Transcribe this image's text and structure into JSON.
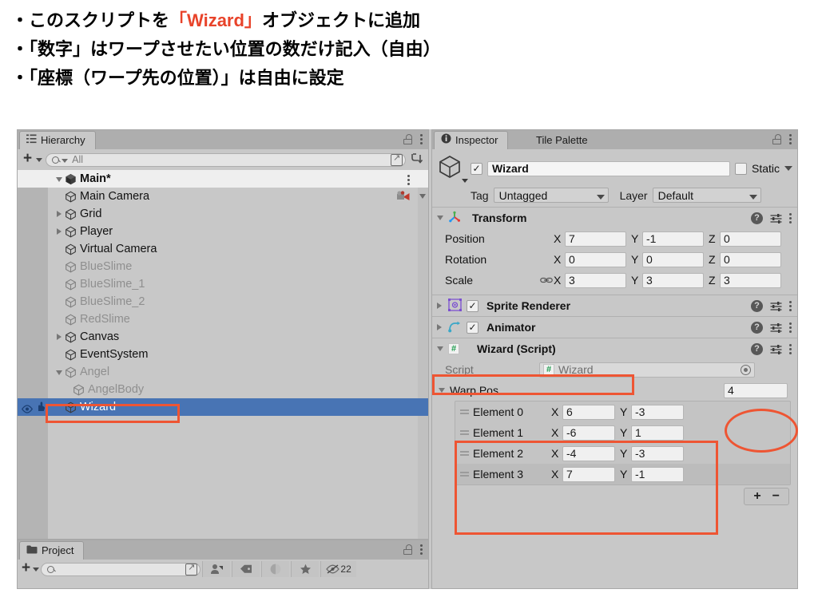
{
  "slide": {
    "bullets": [
      {
        "pre": "・このスクリプトを",
        "red": "「Wizard」",
        "post": "オブジェクトに追加"
      },
      {
        "pre": "・「数字」はワープさせたい位置の数だけ記入（自由）",
        "red": "",
        "post": ""
      },
      {
        "pre": "・「座標（ワープ先の位置）」は自由に設定",
        "red": "",
        "post": ""
      }
    ],
    "accent_color": "#e8432a"
  },
  "hierarchy": {
    "tab_label": "Hierarchy",
    "tab_icon": "hierarchy-icon",
    "lock_icon": "lock-icon",
    "menu_icon": "kebab-icon",
    "add_label": "+",
    "search_placeholder": "All",
    "search_icon": "search-icon",
    "sort_icon": "sort-icon",
    "root": {
      "label": "Main*",
      "expanded": true
    },
    "items": [
      {
        "label": "Main Camera",
        "indent": 2,
        "twisty": "none",
        "dim": false,
        "selected": false,
        "badge": "camera-icon"
      },
      {
        "label": "Grid",
        "indent": 2,
        "twisty": "right",
        "dim": false,
        "selected": false
      },
      {
        "label": "Player",
        "indent": 2,
        "twisty": "right",
        "dim": false,
        "selected": false
      },
      {
        "label": "Virtual Camera",
        "indent": 2,
        "twisty": "none",
        "dim": false,
        "selected": false
      },
      {
        "label": "BlueSlime",
        "indent": 2,
        "twisty": "none",
        "dim": true,
        "selected": false
      },
      {
        "label": "BlueSlime_1",
        "indent": 2,
        "twisty": "none",
        "dim": true,
        "selected": false
      },
      {
        "label": "BlueSlime_2",
        "indent": 2,
        "twisty": "none",
        "dim": true,
        "selected": false
      },
      {
        "label": "RedSlime",
        "indent": 2,
        "twisty": "none",
        "dim": true,
        "selected": false
      },
      {
        "label": "Canvas",
        "indent": 2,
        "twisty": "right",
        "dim": false,
        "selected": false
      },
      {
        "label": "EventSystem",
        "indent": 2,
        "twisty": "none",
        "dim": false,
        "selected": false
      },
      {
        "label": "Angel",
        "indent": 2,
        "twisty": "down",
        "dim": true,
        "selected": false
      },
      {
        "label": "AngelBody",
        "indent": 3,
        "twisty": "none",
        "dim": true,
        "selected": false
      },
      {
        "label": "Wizard",
        "indent": 2,
        "twisty": "none",
        "dim": false,
        "selected": true
      }
    ]
  },
  "project": {
    "tab_label": "Project",
    "tab_icon": "folder-icon",
    "add_label": "+",
    "search_placeholder": "",
    "filter_icons": [
      "search-icon",
      "asset-icon",
      "label-icon",
      "warning-icon",
      "favorite-icon",
      "hidden-icon"
    ],
    "hidden_count": "22"
  },
  "inspector": {
    "tabs": [
      {
        "label": "Inspector",
        "icon": "info-icon",
        "active": true
      },
      {
        "label": "Tile Palette",
        "icon": "",
        "active": false
      }
    ],
    "lock_icon": "lock-icon",
    "menu_icon": "kebab-icon",
    "object": {
      "icon": "gameobject-icon",
      "enabled": true,
      "name": "Wizard",
      "static_label": "Static",
      "static_checked": false,
      "tag_label": "Tag",
      "tag_value": "Untagged",
      "layer_label": "Layer",
      "layer_value": "Default"
    },
    "transform": {
      "title": "Transform",
      "icon": "transform-icon",
      "expanded": true,
      "rows": [
        {
          "name": "Position",
          "linked": false,
          "x": "7",
          "y": "-1",
          "z": "0"
        },
        {
          "name": "Rotation",
          "linked": false,
          "x": "0",
          "y": "0",
          "z": "0"
        },
        {
          "name": "Scale",
          "linked": true,
          "x": "3",
          "y": "3",
          "z": "3"
        }
      ],
      "axis_labels": [
        "X",
        "Y",
        "Z"
      ]
    },
    "components": [
      {
        "title": "Sprite Renderer",
        "icon": "sprite-renderer-icon",
        "enabled": true,
        "expanded": false
      },
      {
        "title": "Animator",
        "icon": "animator-icon",
        "enabled": true,
        "expanded": false
      }
    ],
    "script_component": {
      "title": "Wizard (Script)",
      "icon": "cs-script-icon",
      "expanded": true,
      "script_label": "Script",
      "script_value": "Wizard",
      "array": {
        "label": "Warp Pos",
        "size": "4",
        "expanded": true,
        "axis_labels": [
          "X",
          "Y"
        ],
        "elements": [
          {
            "name": "Element 0",
            "x": "6",
            "y": "-3"
          },
          {
            "name": "Element 1",
            "x": "-6",
            "y": "1"
          },
          {
            "name": "Element 2",
            "x": "-4",
            "y": "-3"
          },
          {
            "name": "Element 3",
            "x": "7",
            "y": "-1"
          }
        ],
        "add_label": "+",
        "remove_label": "−"
      }
    }
  },
  "annotations": {
    "color": "#ee5533",
    "boxes": [
      {
        "name": "wizard-hierarchy-highlight"
      },
      {
        "name": "wizard-script-header-highlight"
      },
      {
        "name": "warp-pos-array-highlight"
      }
    ],
    "ellipses": [
      {
        "name": "array-size-highlight"
      }
    ]
  }
}
